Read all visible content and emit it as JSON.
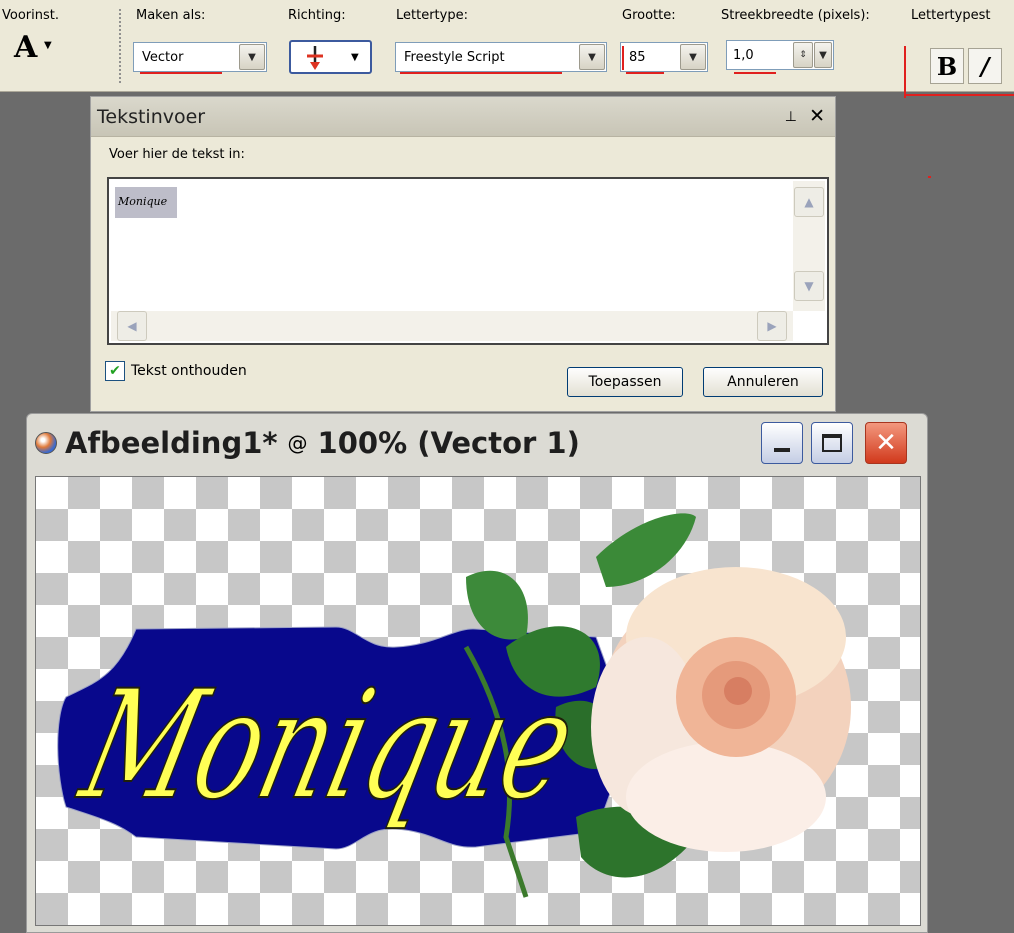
{
  "toolbar": {
    "preset_label": "Voorinst.",
    "preset_icon": "text-tool-icon",
    "create_as_label": "Maken als:",
    "create_as_value": "Vector",
    "direction_label": "Richting:",
    "font_label": "Lettertype:",
    "font_value": "Freestyle Script",
    "size_label": "Grootte:",
    "size_value": "85",
    "stroke_label": "Streekbreedte (pixels):",
    "stroke_value": "1,0",
    "fontstyle_label": "Lettertypest",
    "bold_label": "B",
    "italic_label": "/"
  },
  "dialog": {
    "title": "Tekstinvoer",
    "prompt": "Voer hier de tekst in:",
    "text_value": "Monique",
    "remember_label": "Tekst onthouden",
    "remember_checked": true,
    "apply_label": "Toepassen",
    "cancel_label": "Annuleren"
  },
  "image_window": {
    "name": "Afbeelding1*",
    "at": "@",
    "zoom_layer": "100% (Vector 1)",
    "canvas_text": "Monique"
  },
  "colors": {
    "shape_fill": "#08088c",
    "text_fill": "#ffff55",
    "annotation_red": "#e0201e"
  }
}
